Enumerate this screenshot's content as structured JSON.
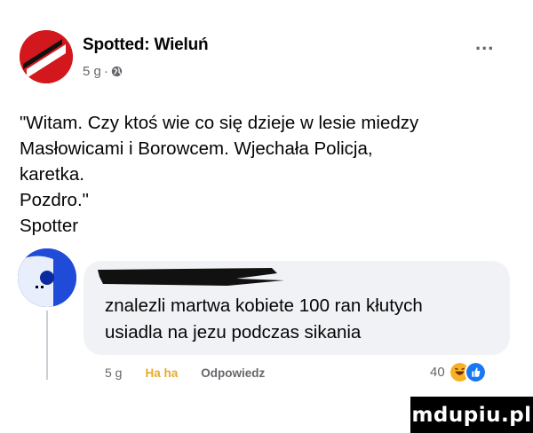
{
  "post": {
    "page_name": "Spotted: Wieluń",
    "timestamp": "5 g",
    "separator": "·",
    "privacy_icon": "globe-icon",
    "more_label": "...",
    "lines": [
      "\"Witam. Czy ktoś wie co się dzieje w lesie miedzy",
      "Masłowicami i Borowcem. Wjechała Policja,",
      "karetka.",
      "Pozdro.\"",
      "Spotter"
    ]
  },
  "comment": {
    "text_lines": [
      "znalezli martwa kobiete 100 ran kłutych",
      "usiadla na jezu podczas sikania"
    ],
    "timestamp": "5 g",
    "reaction_label": "Ha ha",
    "reply_label": "Odpowiedz",
    "reaction_count": "40",
    "reaction_icons": [
      "haha-icon",
      "like-icon"
    ]
  },
  "colors": {
    "avatar": "#d3181d",
    "comment_avatar": "#1f4bd8",
    "haha": "#e6ab2e",
    "like": "#1877f2"
  },
  "watermark": "mdupiu.pl"
}
